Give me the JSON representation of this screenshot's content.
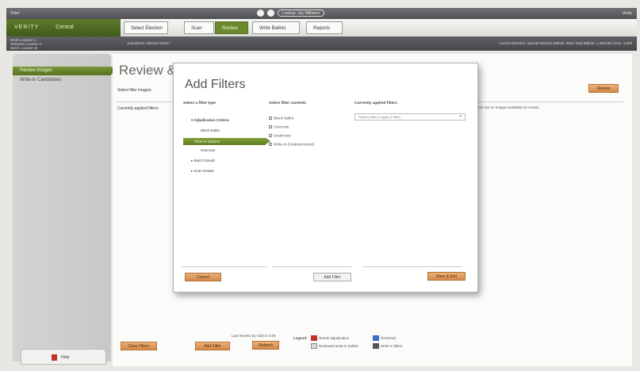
{
  "topbar": {
    "left": "Voter",
    "right": "Verity",
    "pill": "Lookup: Jay Williams"
  },
  "brand": {
    "name": "VERITY",
    "product": "Central"
  },
  "nav": {
    "crumbs": [
      "Select Election",
      "Scan",
      "Review",
      "Write Ballots",
      "Reports"
    ],
    "active": "Review"
  },
  "infostrip": {
    "line1": "Work Location A",
    "line2": "Selected Location A",
    "line3": "Batch Location B",
    "mid": "Jurisdiction: Election Batch",
    "right": "Current Election: Special Election   Ballots: 4500   Total Ballots: 1,200,000   Scan: 4,500"
  },
  "sidebar": {
    "item1": "Review Images",
    "item2": "Write-in Candidates",
    "help": "Help"
  },
  "main": {
    "title": "Review & Adjudicate",
    "sub1": "Select filter images:",
    "sub2": "Currently applied filters:",
    "avail": "There are no images available for review.",
    "top_btn": "Review",
    "btn_clear": "Clear Filters",
    "btn_add": "Add Filter",
    "status_text": "Last Review by Sold in 4:06",
    "btn_refresh": "Refresh",
    "legend_label": "Legend:",
    "legend_items": [
      "Needs adjudication",
      "Reviewed write-in ballots",
      "Resolved",
      "Write-in filters"
    ]
  },
  "modal": {
    "title": "Add Filters",
    "col1_header": "Select a filter type",
    "col2_header": "Select filter contents",
    "col3_header": "Currently applied filters",
    "tree": [
      "Adjudication Criteria",
      "Blank Ballot",
      "Write-in Options",
      "Overvote",
      "Batch Details",
      "Scan Details"
    ],
    "selected": "Write-in Options",
    "checks": [
      "Blank Ballot",
      "Overvote",
      "Undervote",
      "Write-in (Undetermined)"
    ],
    "dropdown": "Select a filter to apply (1 filter)",
    "btn_cancel": "Cancel",
    "btn_add": "Add Filter",
    "btn_save": "Save & Exit"
  },
  "colors": {
    "green": "#6b8a2e",
    "orange": "#e09a58",
    "legend_red": "#c0332a",
    "legend_blue": "#3a6fc4"
  }
}
